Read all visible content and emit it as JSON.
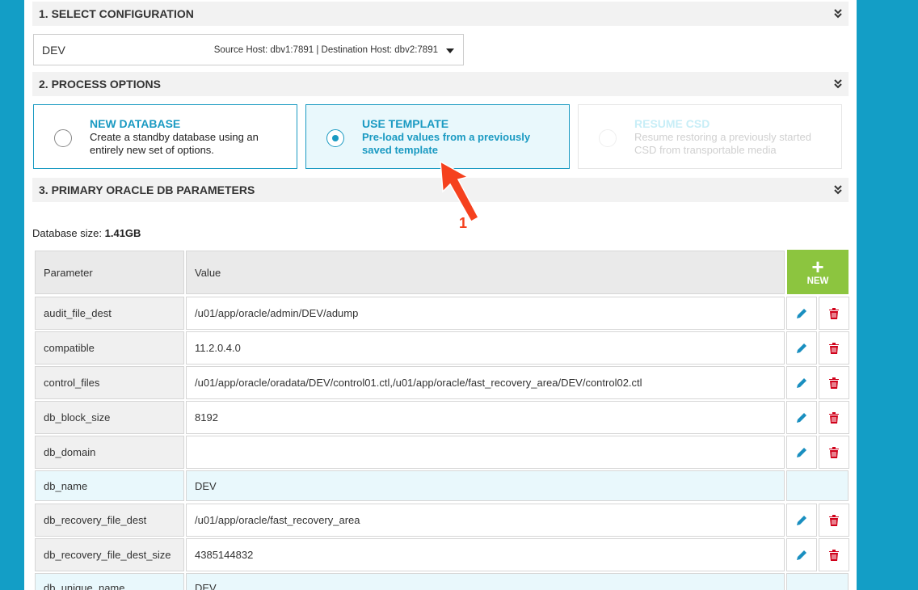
{
  "sections": {
    "select_configuration": "1. SELECT CONFIGURATION",
    "process_options": "2. PROCESS OPTIONS",
    "primary_params": "3. PRIMARY ORACLE DB PARAMETERS"
  },
  "config": {
    "name": "DEV",
    "hosts": "Source Host: dbv1:7891 | Destination Host: dbv2:7891"
  },
  "options": [
    {
      "title": "NEW DATABASE",
      "desc": "Create a standby database using an entirely new set of options.",
      "state": "unselected"
    },
    {
      "title": "USE TEMPLATE",
      "desc": "Pre-load values from a previously saved template",
      "state": "selected"
    },
    {
      "title": "RESUME CSD",
      "desc": "Resume restoring a previously started CSD from transportable media",
      "state": "disabled"
    }
  ],
  "database_size": {
    "label": "Database size:",
    "value": "1.41GB"
  },
  "table": {
    "headers": {
      "parameter": "Parameter",
      "value": "Value"
    },
    "new_button": "NEW",
    "rows": [
      {
        "param": "audit_file_dest",
        "value": "/u01/app/oracle/admin/DEV/adump",
        "editable": true
      },
      {
        "param": "compatible",
        "value": "11.2.0.4.0",
        "editable": true
      },
      {
        "param": "control_files",
        "value": "/u01/app/oracle/oradata/DEV/control01.ctl,/u01/app/oracle/fast_recovery_area/DEV/control02.ctl",
        "editable": true
      },
      {
        "param": "db_block_size",
        "value": "8192",
        "editable": true
      },
      {
        "param": "db_domain",
        "value": "",
        "editable": true
      },
      {
        "param": "db_name",
        "value": "DEV",
        "editable": false
      },
      {
        "param": "db_recovery_file_dest",
        "value": "/u01/app/oracle/fast_recovery_area",
        "editable": true
      },
      {
        "param": "db_recovery_file_dest_size",
        "value": "4385144832",
        "editable": true
      },
      {
        "param": "db_unique_name",
        "value": "DEV",
        "editable": false
      }
    ]
  },
  "annotation": {
    "label": "1"
  },
  "colors": {
    "background": "#139ec6",
    "accent": "#1a9ac2",
    "new_button": "#8cc53f",
    "delete": "#d0021b",
    "highlight": "#e9f8fc"
  }
}
